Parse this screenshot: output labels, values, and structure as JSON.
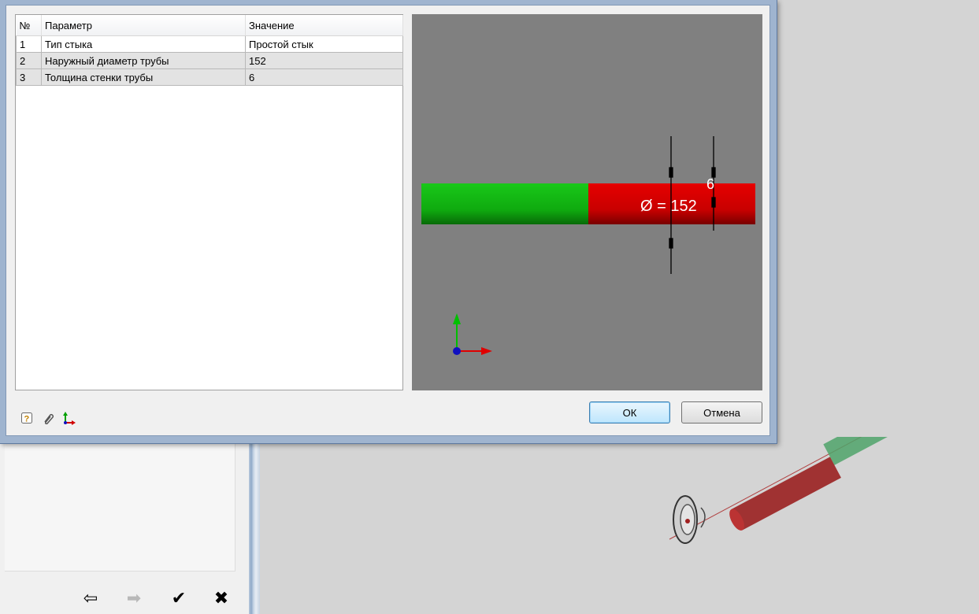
{
  "table": {
    "headers": {
      "num": "№",
      "param": "Параметр",
      "value": "Значение"
    },
    "rows": [
      {
        "num": "1",
        "param": "Тип стыка",
        "value": "Простой стык"
      },
      {
        "num": "2",
        "param": "Наружный диаметр трубы",
        "value": "152"
      },
      {
        "num": "3",
        "param": "Толщина стенки трубы",
        "value": "6"
      }
    ]
  },
  "preview": {
    "diameter_label": "Ø = 152",
    "wall_label": "6",
    "colors": {
      "background": "#808080",
      "pipe_green": "#19c819",
      "pipe_red": "#e60000"
    }
  },
  "toolbar": {
    "icons": [
      "help-icon",
      "paperclip-icon",
      "axes-icon"
    ]
  },
  "buttons": {
    "ok": "ОК",
    "cancel": "Отмена"
  },
  "navigation": {
    "back": "⇦",
    "forward": "➡",
    "apply": "✔",
    "close": "✖"
  }
}
